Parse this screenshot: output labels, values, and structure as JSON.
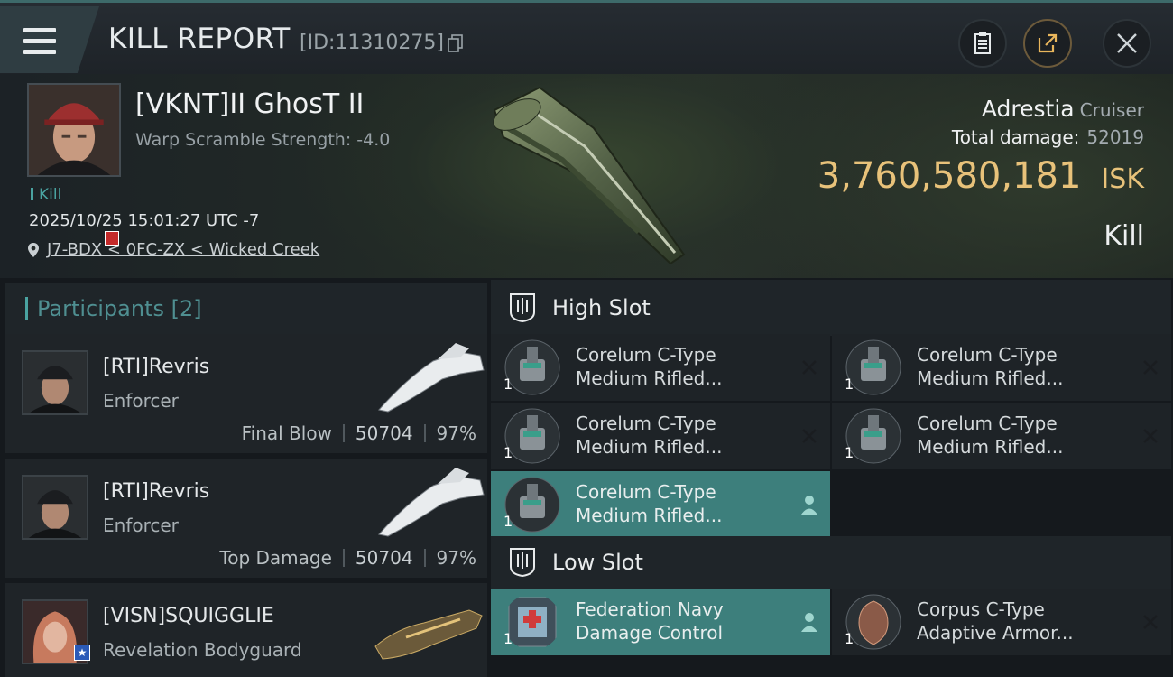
{
  "header": {
    "title": "KILL REPORT",
    "kill_id": "[ID:11310275]"
  },
  "victim": {
    "name": "[VKNT]II GhosT II",
    "warp_scramble": "Warp Scramble Strength: -4.0",
    "tag": "Kill",
    "datetime": "2025/10/25 15:01:27 UTC -7",
    "location": "J7-BDX < 0FC-ZX < Wicked Creek",
    "ship_name": "Adrestia",
    "ship_class": "Cruiser",
    "total_damage_label": "Total damage:",
    "total_damage": "52019",
    "isk_value": "3,760,580,181",
    "isk_unit": "ISK",
    "result": "Kill"
  },
  "participants": {
    "label": "Participants",
    "count": "[2]",
    "rows": [
      {
        "name": "[RTI]Revris",
        "ship": "Enforcer",
        "role": "Final Blow",
        "damage": "50704",
        "percent": "97%"
      },
      {
        "name": "[RTI]Revris",
        "ship": "Enforcer",
        "role": "Top Damage",
        "damage": "50704",
        "percent": "97%"
      },
      {
        "name": "[VISN]SQUIGGLIE",
        "ship": "Revelation Bodyguard"
      }
    ]
  },
  "high_slot": {
    "title": "High Slot",
    "modules": [
      {
        "name": "Corelum C-Type Medium Rifled...",
        "qty": "1"
      },
      {
        "name": "Corelum C-Type Medium Rifled...",
        "qty": "1"
      },
      {
        "name": "Corelum C-Type Medium Rifled...",
        "qty": "1"
      },
      {
        "name": "Corelum C-Type Medium Rifled...",
        "qty": "1"
      },
      {
        "name": "Corelum C-Type Medium Rifled...",
        "qty": "1"
      }
    ]
  },
  "low_slot": {
    "title": "Low Slot",
    "modules": [
      {
        "name": "Federation Navy Damage Control",
        "qty": "1"
      },
      {
        "name": "Corpus C-Type Adaptive Armor...",
        "qty": "1"
      }
    ]
  },
  "colors": {
    "accent_teal": "#4aa3a1",
    "isk_gold": "#e8c27a",
    "highlight_row": "#3d7f7c"
  },
  "icons": [
    "menu-icon",
    "copy-icon",
    "clipboard-icon",
    "share-icon",
    "close-icon",
    "location-pin-icon",
    "slot-icon",
    "x-icon",
    "pilot-icon"
  ]
}
